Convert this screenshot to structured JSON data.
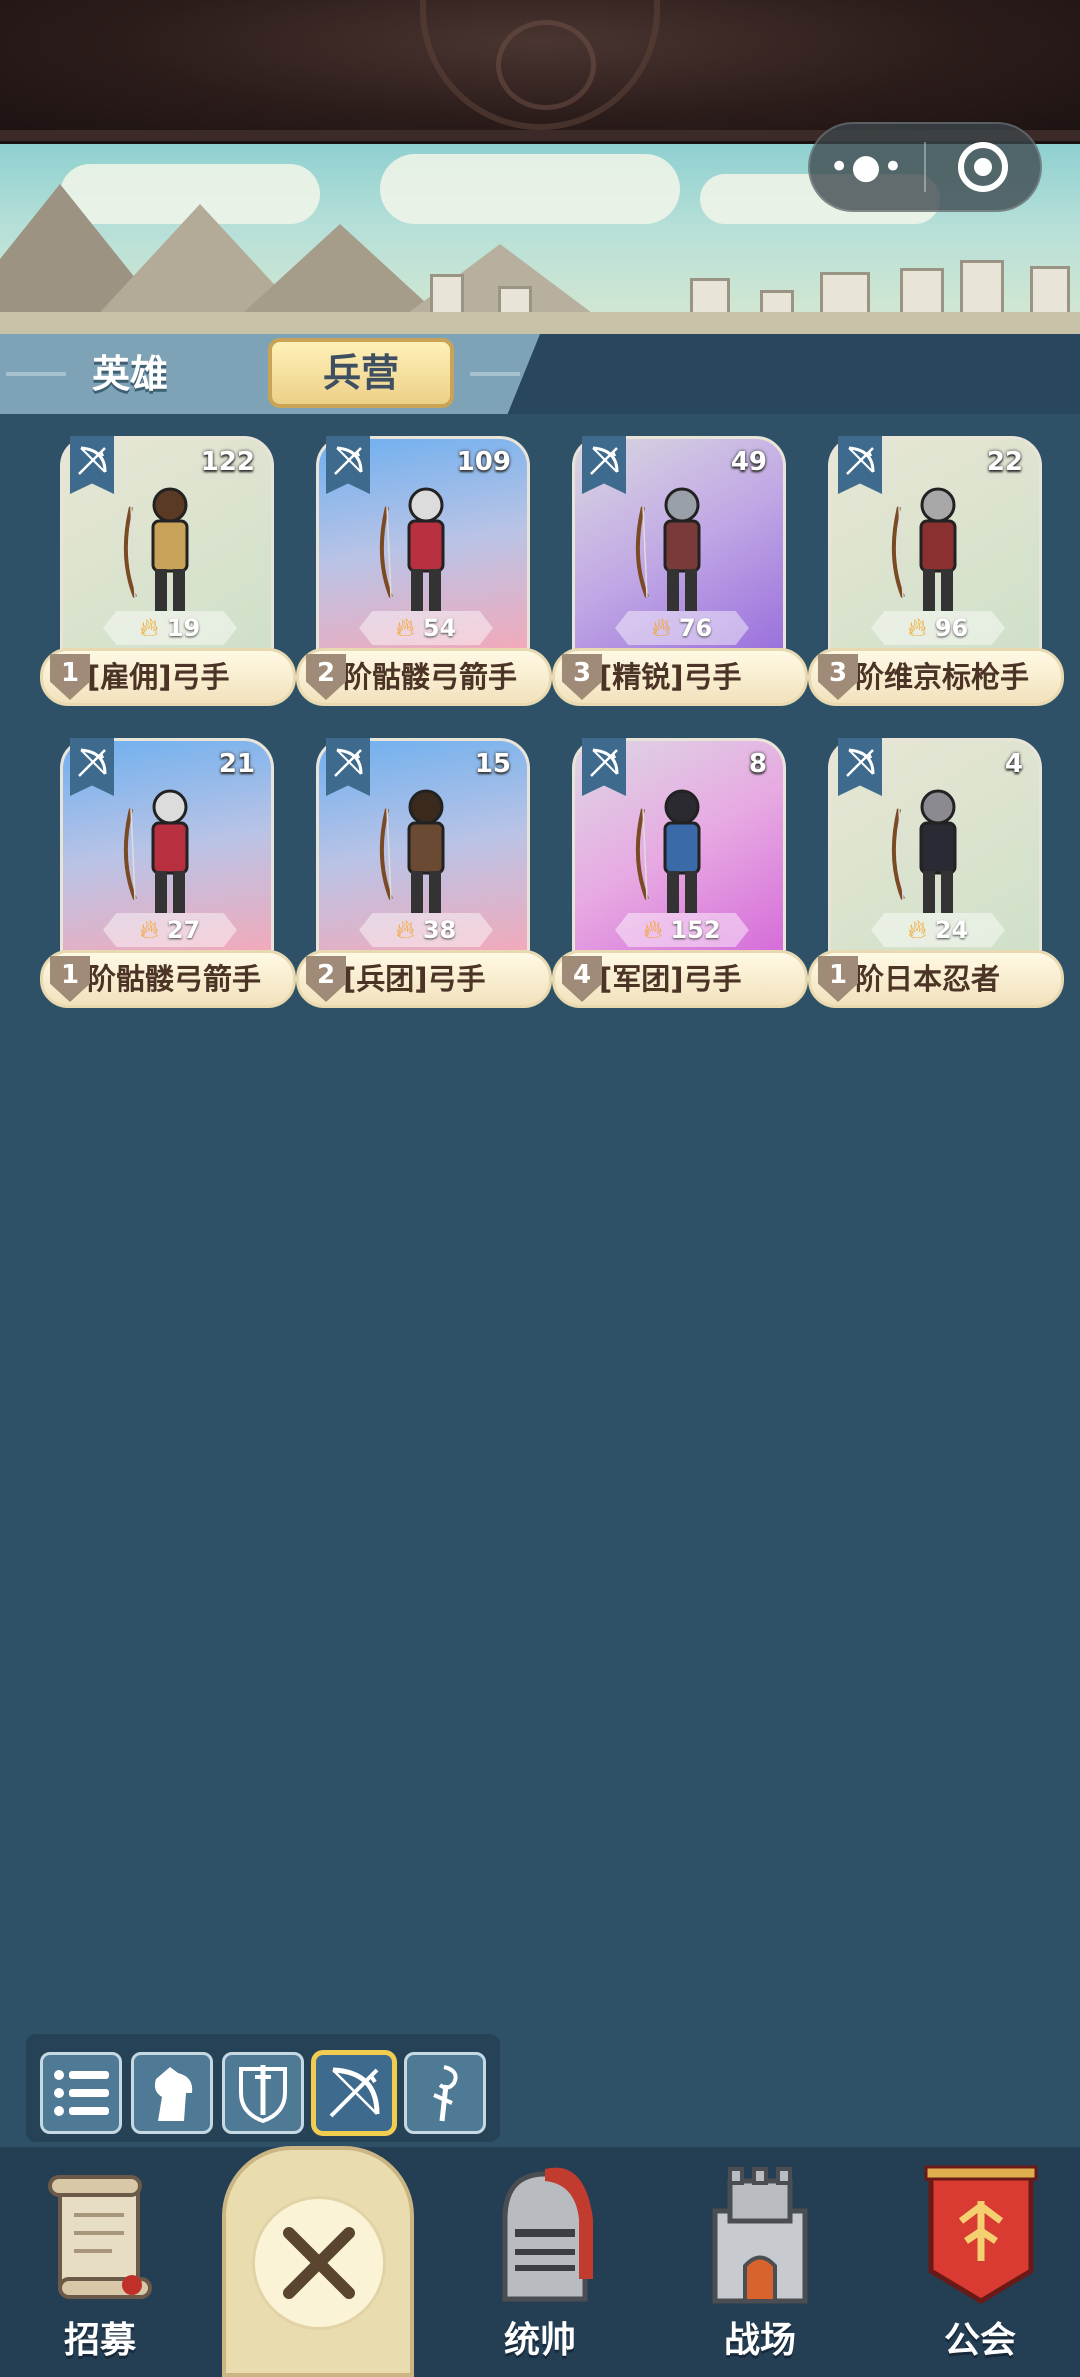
{
  "capsule": {
    "more_icon": "more-dots-icon",
    "close_icon": "target-icon"
  },
  "tabs": {
    "hero": "英雄",
    "barracks": "兵营",
    "active": "barracks"
  },
  "units": [
    {
      "name": "[雇佣]弓手",
      "tier": "1",
      "count": "122",
      "power": "19",
      "bg": "bg-1",
      "class_icon": "bow-icon"
    },
    {
      "name": "阶骷髅弓箭手",
      "tier": "2",
      "count": "109",
      "power": "54",
      "bg": "bg-2",
      "class_icon": "bow-icon"
    },
    {
      "name": "[精锐]弓手",
      "tier": "3",
      "count": "49",
      "power": "76",
      "bg": "bg-3",
      "class_icon": "bow-icon"
    },
    {
      "name": "阶维京标枪手",
      "tier": "3",
      "count": "22",
      "power": "96",
      "bg": "bg-1",
      "class_icon": "bow-icon"
    },
    {
      "name": "阶骷髅弓箭手",
      "tier": "1",
      "count": "21",
      "power": "27",
      "bg": "bg-2",
      "class_icon": "bow-icon"
    },
    {
      "name": "[兵团]弓手",
      "tier": "2",
      "count": "15",
      "power": "38",
      "bg": "bg-2",
      "class_icon": "bow-icon"
    },
    {
      "name": "[军团]弓手",
      "tier": "4",
      "count": "8",
      "power": "152",
      "bg": "bg-4",
      "class_icon": "bow-icon"
    },
    {
      "name": "阶日本忍者",
      "tier": "1",
      "count": "4",
      "power": "24",
      "bg": "bg-1",
      "class_icon": "bow-icon"
    }
  ],
  "filters": [
    {
      "icon": "list-icon",
      "active": false
    },
    {
      "icon": "horse-icon",
      "active": false
    },
    {
      "icon": "shield-sword-icon",
      "active": false
    },
    {
      "icon": "bow-icon",
      "active": true
    },
    {
      "icon": "staff-icon",
      "active": false
    }
  ],
  "nav": {
    "recruit": "招募",
    "commander": "统帅",
    "battlefield": "战场",
    "guild": "公会",
    "center_icon": "close-icon"
  },
  "colors": {
    "background": "#2f5168",
    "accent": "#f2cc4f",
    "nav": "#243e53"
  }
}
